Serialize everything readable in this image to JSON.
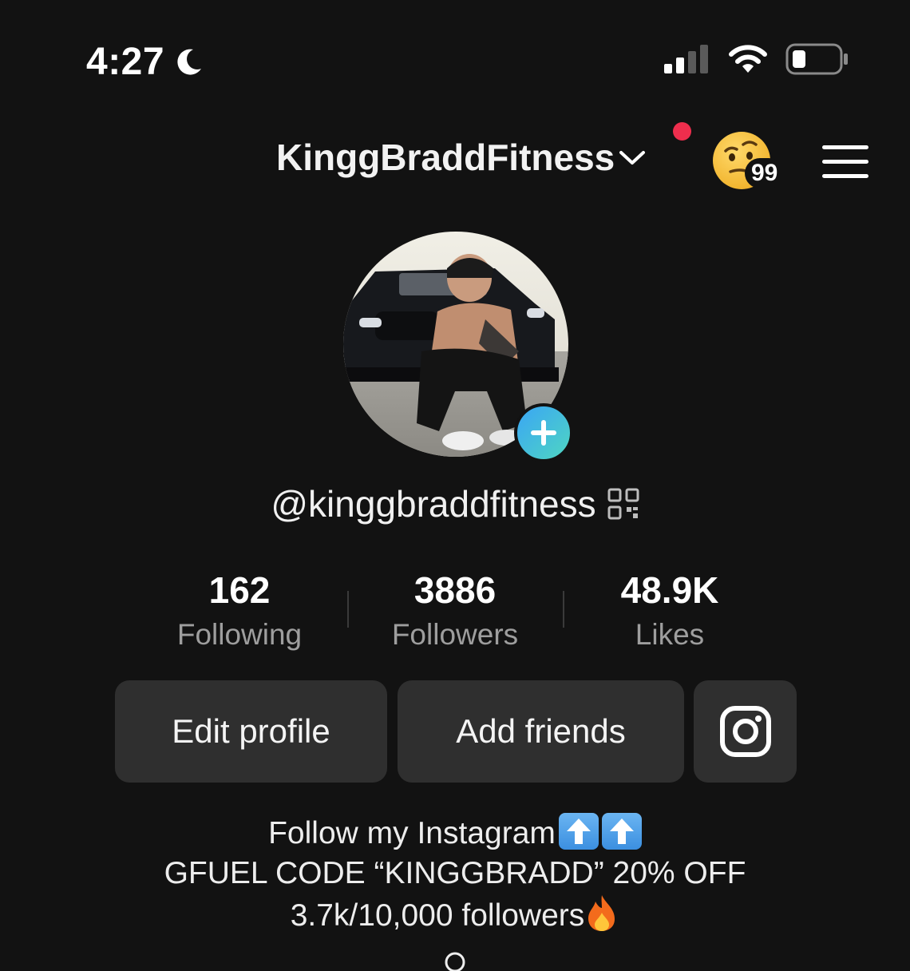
{
  "status_bar": {
    "time": "4:27",
    "focus_icon": "moon-icon",
    "signal_icon": "cellular-signal-icon",
    "wifi_icon": "wifi-icon",
    "battery_icon": "battery-low-icon"
  },
  "header": {
    "username": "KinggBraddFitness",
    "dropdown_icon": "chevron-down-icon",
    "has_notification_dot": true,
    "emoji_icon": "raised-eyebrow-face-icon",
    "emoji_count": "99",
    "menu_icon": "hamburger-menu-icon"
  },
  "profile": {
    "handle": "@kinggbraddfitness",
    "qr_icon": "qr-code-icon",
    "add_avatar_icon": "plus-icon"
  },
  "stats": [
    {
      "value": "162",
      "label": "Following"
    },
    {
      "value": "3886",
      "label": "Followers"
    },
    {
      "value": "48.9K",
      "label": "Likes"
    }
  ],
  "actions": {
    "edit_profile_label": "Edit profile",
    "add_friends_label": "Add friends",
    "instagram_icon": "instagram-icon"
  },
  "bio": {
    "line1": "Follow my Instagram",
    "line1_emoji": "up-arrow-emoji-icon",
    "line2": "GFUEL CODE “KINGGBRADD” 20% OFF",
    "line3": "3.7k/10,000 followers",
    "line3_emoji": "fire-emoji-icon"
  },
  "colors": {
    "background": "#121212",
    "button_bg": "#2f2f2f",
    "muted_text": "#9e9e9e",
    "notification_dot": "#ee2e4d",
    "avatar_add_gradient_start": "#3aa5f5",
    "avatar_add_gradient_end": "#4fd6c2"
  }
}
